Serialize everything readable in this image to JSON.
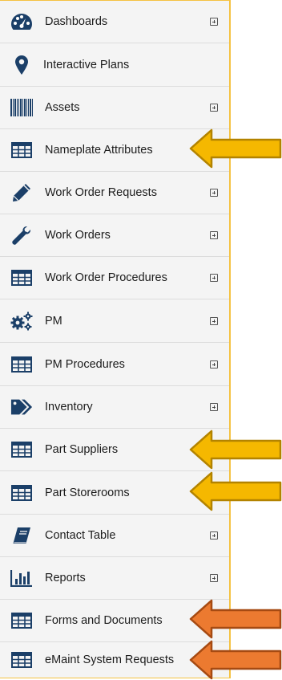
{
  "menu": {
    "items": [
      {
        "label": "Dashboards",
        "icon": "dashboard-icon",
        "expandable": true
      },
      {
        "label": "Interactive Plans",
        "icon": "map-pin-icon",
        "expandable": false
      },
      {
        "label": "Assets",
        "icon": "barcode-icon",
        "expandable": true
      },
      {
        "label": "Nameplate Attributes",
        "icon": "table-icon",
        "expandable": false
      },
      {
        "label": "Work Order Requests",
        "icon": "pencil-icon",
        "expandable": true
      },
      {
        "label": "Work Orders",
        "icon": "wrench-icon",
        "expandable": true
      },
      {
        "label": "Work Order Procedures",
        "icon": "table-icon",
        "expandable": true
      },
      {
        "label": "PM",
        "icon": "gears-icon",
        "expandable": true
      },
      {
        "label": "PM Procedures",
        "icon": "table-icon",
        "expandable": true
      },
      {
        "label": "Inventory",
        "icon": "tag-icon",
        "expandable": true
      },
      {
        "label": "Part Suppliers",
        "icon": "table-icon",
        "expandable": false
      },
      {
        "label": "Part Storerooms",
        "icon": "table-icon",
        "expandable": false
      },
      {
        "label": "Contact Table",
        "icon": "book-icon",
        "expandable": true
      },
      {
        "label": "Reports",
        "icon": "bar-chart-icon",
        "expandable": true
      },
      {
        "label": "Forms and Documents",
        "icon": "table-icon",
        "expandable": false
      },
      {
        "label": "eMaint System Requests",
        "icon": "table-icon",
        "expandable": false
      }
    ]
  },
  "callouts": [
    {
      "target": "Nameplate Attributes",
      "color": "#f5b800"
    },
    {
      "target": "Part Suppliers",
      "color": "#f5b800"
    },
    {
      "target": "Part Storerooms",
      "color": "#f5b800"
    },
    {
      "target": "Forms and Documents",
      "color": "#ec7a30"
    },
    {
      "target": "eMaint System Requests",
      "color": "#ec7a30"
    }
  ],
  "colors": {
    "icon": "#1b3f68",
    "frame": "#f5c242"
  }
}
